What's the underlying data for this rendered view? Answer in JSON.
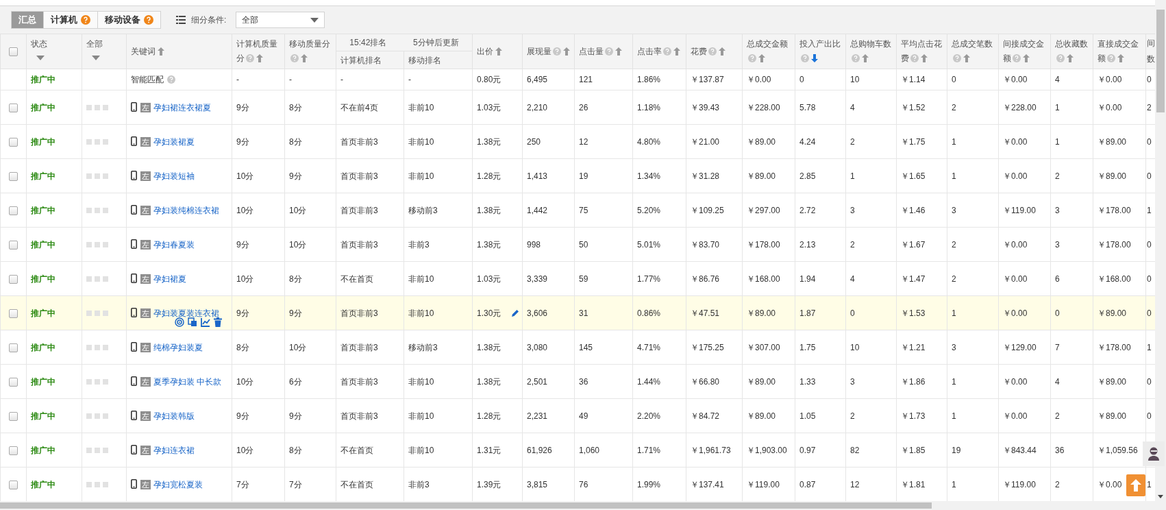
{
  "toolbar": {
    "tabs": [
      {
        "label": "汇总",
        "selected": true,
        "help": false
      },
      {
        "label": "计算机",
        "selected": false,
        "help": true
      },
      {
        "label": "移动设备",
        "selected": false,
        "help": true
      }
    ],
    "filter_label": "细分条件:",
    "filter_value": "全部"
  },
  "columns": [
    {
      "kind": "checkbox",
      "checked": false
    },
    {
      "kind": "dropdown",
      "label": "状态"
    },
    {
      "kind": "dropdown",
      "label": "全部"
    },
    {
      "kind": "sort",
      "label": "关键词",
      "help": false,
      "sorted": false
    },
    {
      "kind": "sort",
      "label": "计算机质量分",
      "help": true,
      "sorted": false
    },
    {
      "kind": "sort",
      "label": "移动质量分",
      "help": true,
      "sorted": false
    },
    {
      "kind": "group",
      "labels": [
        "15:42排名",
        "5分钟后更新"
      ],
      "children": [
        "计算机排名",
        "移动排名"
      ]
    },
    {
      "kind": "sort",
      "label": "出价",
      "help": false,
      "sorted": false
    },
    {
      "kind": "sort",
      "label": "展现量",
      "help": true,
      "sorted": false
    },
    {
      "kind": "sort",
      "label": "点击量",
      "help": true,
      "sorted": false
    },
    {
      "kind": "sort",
      "label": "点击率",
      "help": true,
      "sorted": false
    },
    {
      "kind": "sort",
      "label": "花费",
      "help": true,
      "sorted": false
    },
    {
      "kind": "sort",
      "label": "总成交金额",
      "help": true,
      "sorted": false
    },
    {
      "kind": "sort",
      "label": "投入产出比",
      "help": true,
      "sorted": true
    },
    {
      "kind": "sort",
      "label": "总购物车数",
      "help": true,
      "sorted": false
    },
    {
      "kind": "sort",
      "label": "平均点击花费",
      "help": true,
      "sorted": false
    },
    {
      "kind": "sort",
      "label": "总成交笔数",
      "help": true,
      "sorted": false
    },
    {
      "kind": "sort",
      "label": "间接成交金额",
      "help": true,
      "sorted": false
    },
    {
      "kind": "sort",
      "label": "总收藏数",
      "help": true,
      "sorted": false
    },
    {
      "kind": "sort",
      "label": "直接成交金额",
      "help": true,
      "sorted": false
    },
    {
      "kind": "cut",
      "label": "间数"
    }
  ],
  "rows": [
    {
      "kind": "smart",
      "status": "推广中",
      "keyword": "智能匹配",
      "highlighted": false,
      "cells": [
        "-",
        "-",
        "-",
        "-",
        "0.80元",
        "6,495",
        "121",
        "1.86%",
        "￥137.87",
        "￥0.00",
        "0",
        "10",
        "￥1.14",
        "0",
        "￥0.00",
        "4",
        "￥0.00",
        "0"
      ]
    },
    {
      "kind": "keyword",
      "checked": false,
      "status": "推广中",
      "badge": "左",
      "keyword": "孕妇裙连衣裙夏",
      "highlighted": false,
      "cells": [
        "9分",
        "8分",
        "不在前4页",
        "非前10",
        "1.03元",
        "2,210",
        "26",
        "1.18%",
        "￥39.43",
        "￥228.00",
        "5.78",
        "4",
        "￥1.52",
        "2",
        "￥228.00",
        "1",
        "￥0.00",
        "2"
      ]
    },
    {
      "kind": "keyword",
      "checked": false,
      "status": "推广中",
      "badge": "左",
      "keyword": "孕妇装裙夏",
      "highlighted": false,
      "cells": [
        "9分",
        "8分",
        "首页非前3",
        "非前10",
        "1.38元",
        "250",
        "12",
        "4.80%",
        "￥21.00",
        "￥89.00",
        "4.24",
        "2",
        "￥1.75",
        "1",
        "￥0.00",
        "1",
        "￥89.00",
        "0"
      ]
    },
    {
      "kind": "keyword",
      "checked": false,
      "status": "推广中",
      "badge": "左",
      "keyword": "孕妇装短袖",
      "highlighted": false,
      "cells": [
        "10分",
        "9分",
        "首页非前3",
        "非前10",
        "1.28元",
        "1,413",
        "19",
        "1.34%",
        "￥31.28",
        "￥89.00",
        "2.85",
        "1",
        "￥1.65",
        "1",
        "￥0.00",
        "2",
        "￥89.00",
        "0"
      ]
    },
    {
      "kind": "keyword",
      "checked": false,
      "status": "推广中",
      "badge": "左",
      "keyword": "孕妇装纯棉连衣裙",
      "highlighted": false,
      "cells": [
        "10分",
        "10分",
        "首页非前3",
        "移动前3",
        "1.38元",
        "1,442",
        "75",
        "5.20%",
        "￥109.25",
        "￥297.00",
        "2.72",
        "3",
        "￥1.46",
        "3",
        "￥119.00",
        "3",
        "￥178.00",
        "1"
      ]
    },
    {
      "kind": "keyword",
      "checked": false,
      "status": "推广中",
      "badge": "左",
      "keyword": "孕妇春夏装",
      "highlighted": false,
      "cells": [
        "9分",
        "10分",
        "首页非前3",
        "非前3",
        "1.38元",
        "998",
        "50",
        "5.01%",
        "￥83.70",
        "￥178.00",
        "2.13",
        "2",
        "￥1.67",
        "2",
        "￥0.00",
        "3",
        "￥178.00",
        "0"
      ]
    },
    {
      "kind": "keyword",
      "checked": false,
      "status": "推广中",
      "badge": "左",
      "keyword": "孕妇裙夏",
      "highlighted": false,
      "cells": [
        "10分",
        "8分",
        "不在首页",
        "非前10",
        "1.03元",
        "3,339",
        "59",
        "1.77%",
        "￥86.76",
        "￥168.00",
        "1.94",
        "4",
        "￥1.47",
        "2",
        "￥0.00",
        "6",
        "￥168.00",
        "0"
      ]
    },
    {
      "kind": "keyword",
      "checked": false,
      "status": "推广中",
      "badge": "左",
      "keyword": "孕妇装夏装连衣裙",
      "highlighted": true,
      "cells": [
        "9分",
        "9分",
        "首页非前3",
        "非前10",
        "1.30元",
        "3,606",
        "31",
        "0.86%",
        "￥47.51",
        "￥89.00",
        "1.87",
        "0",
        "￥1.53",
        "1",
        "￥0.00",
        "0",
        "￥89.00",
        "0"
      ]
    },
    {
      "kind": "keyword",
      "checked": false,
      "status": "推广中",
      "badge": "左",
      "keyword": "纯棉孕妇装夏",
      "highlighted": false,
      "cells": [
        "8分",
        "10分",
        "首页非前3",
        "移动前3",
        "1.38元",
        "3,080",
        "145",
        "4.71%",
        "￥175.25",
        "￥307.00",
        "1.75",
        "10",
        "￥1.21",
        "3",
        "￥129.00",
        "7",
        "￥178.00",
        "1"
      ]
    },
    {
      "kind": "keyword",
      "checked": false,
      "status": "推广中",
      "badge": "左",
      "keyword": "夏季孕妇装 中长款",
      "highlighted": false,
      "cells": [
        "10分",
        "6分",
        "首页非前3",
        "非前10",
        "1.38元",
        "2,501",
        "36",
        "1.44%",
        "￥66.80",
        "￥89.00",
        "1.33",
        "3",
        "￥1.86",
        "1",
        "￥0.00",
        "4",
        "￥89.00",
        "0"
      ]
    },
    {
      "kind": "keyword",
      "checked": false,
      "status": "推广中",
      "badge": "左",
      "keyword": "孕妇装韩版",
      "highlighted": false,
      "cells": [
        "9分",
        "9分",
        "首页非前3",
        "非前10",
        "1.28元",
        "2,231",
        "49",
        "2.20%",
        "￥84.72",
        "￥89.00",
        "1.05",
        "2",
        "￥1.73",
        "1",
        "￥0.00",
        "2",
        "￥89.00",
        "0"
      ]
    },
    {
      "kind": "keyword",
      "checked": false,
      "status": "推广中",
      "badge": "左",
      "keyword": "孕妇连衣裙",
      "highlighted": false,
      "cells": [
        "10分",
        "8分",
        "不在首页",
        "非前10",
        "1.31元",
        "61,926",
        "1,060",
        "1.71%",
        "￥1,961.73",
        "￥1,903.00",
        "0.97",
        "82",
        "￥1.85",
        "19",
        "￥843.44",
        "36",
        "￥1,059.56"
      ]
    },
    {
      "kind": "keyword",
      "checked": false,
      "status": "推广中",
      "badge": "左",
      "keyword": "孕妇宽松夏装",
      "highlighted": false,
      "cells": [
        "7分",
        "7分",
        "不在首页",
        "非前3",
        "1.39元",
        "3,815",
        "76",
        "1.99%",
        "￥137.41",
        "￥119.00",
        "0.87",
        "12",
        "￥1.81",
        "1",
        "￥119.00",
        "2",
        "￥0.00",
        "1"
      ]
    }
  ]
}
